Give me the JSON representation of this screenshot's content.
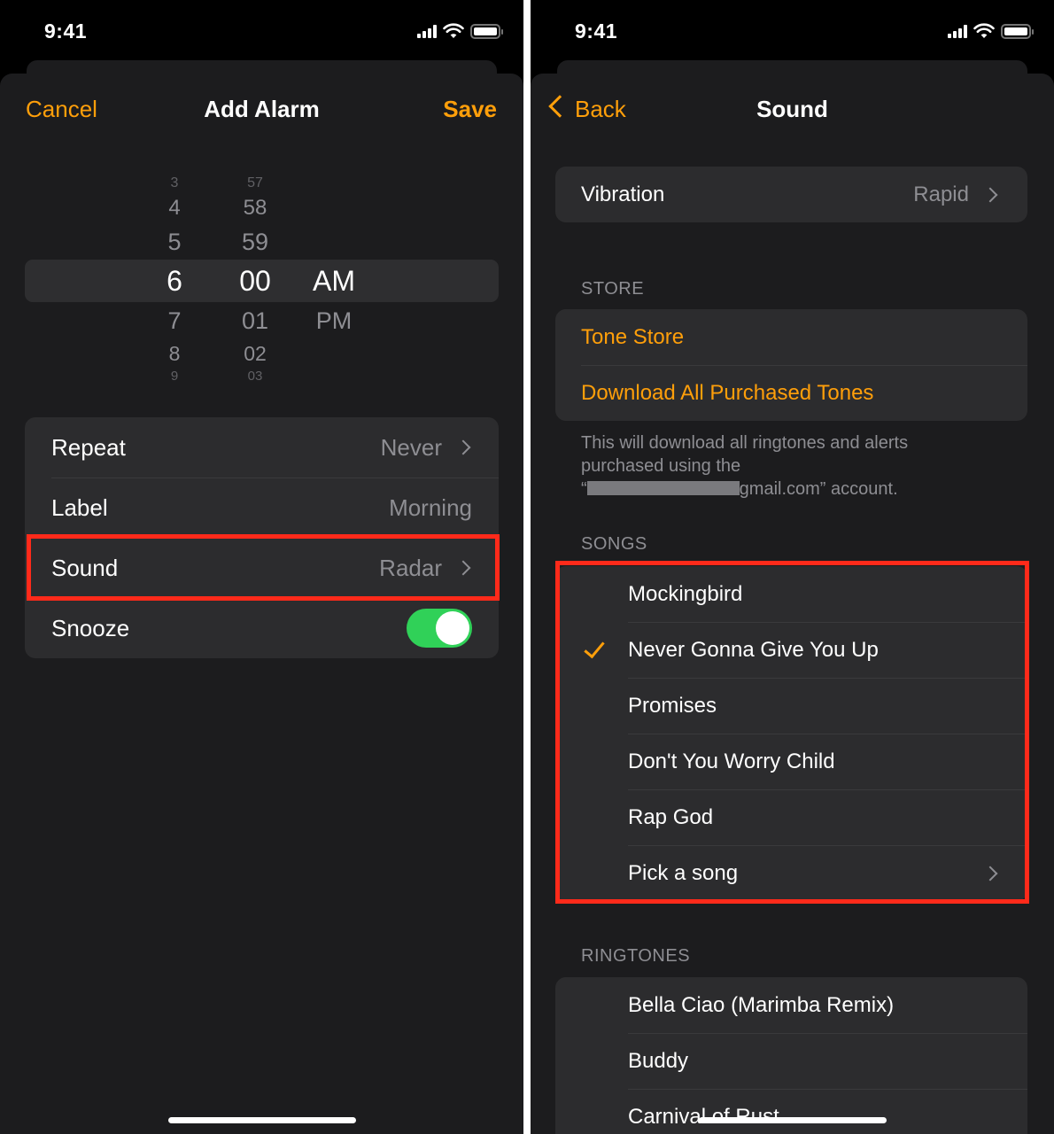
{
  "left_screen": {
    "status_time": "9:41",
    "nav": {
      "cancel": "Cancel",
      "title": "Add Alarm",
      "save": "Save"
    },
    "picker": {
      "hours": [
        "3",
        "4",
        "5",
        "6",
        "7",
        "8",
        "9"
      ],
      "minutes": [
        "57",
        "58",
        "59",
        "00",
        "01",
        "02",
        "03"
      ],
      "periods": [
        "AM",
        "PM"
      ],
      "selected": {
        "hour": "6",
        "minute": "00",
        "period": "AM"
      }
    },
    "settings": [
      {
        "label": "Repeat",
        "value": "Never"
      },
      {
        "label": "Label",
        "value": "Morning"
      },
      {
        "label": "Sound",
        "value": "Radar"
      },
      {
        "label": "Snooze",
        "toggle_on": true
      }
    ]
  },
  "right_screen": {
    "status_time": "9:41",
    "nav": {
      "back": "Back",
      "title": "Sound"
    },
    "vibration": {
      "label": "Vibration",
      "value": "Rapid"
    },
    "store": {
      "header": "STORE",
      "tone_store": "Tone Store",
      "download_all": "Download All Purchased Tones",
      "footnote_line1": "This will download all ringtones and alerts",
      "footnote_line2": "purchased using the",
      "footnote_line3_prefix": "“",
      "footnote_line3_suffix": "gmail.com” account."
    },
    "songs": {
      "header": "SONGS",
      "items": [
        "Mockingbird",
        "Never Gonna Give You Up",
        "Promises",
        "Don't You Worry Child",
        "Rap God",
        "Pick a song"
      ],
      "selected_index": 1
    },
    "ringtones": {
      "header": "RINGTONES",
      "items": [
        "Bella Ciao (Marimba Remix)",
        "Buddy",
        "Carnival of Rust"
      ]
    }
  },
  "colors": {
    "accent": "#ff9f0a",
    "highlight": "#ff2a1a",
    "toggle_on": "#30d158",
    "background": "#1c1c1e",
    "cell": "#2c2c2e"
  }
}
